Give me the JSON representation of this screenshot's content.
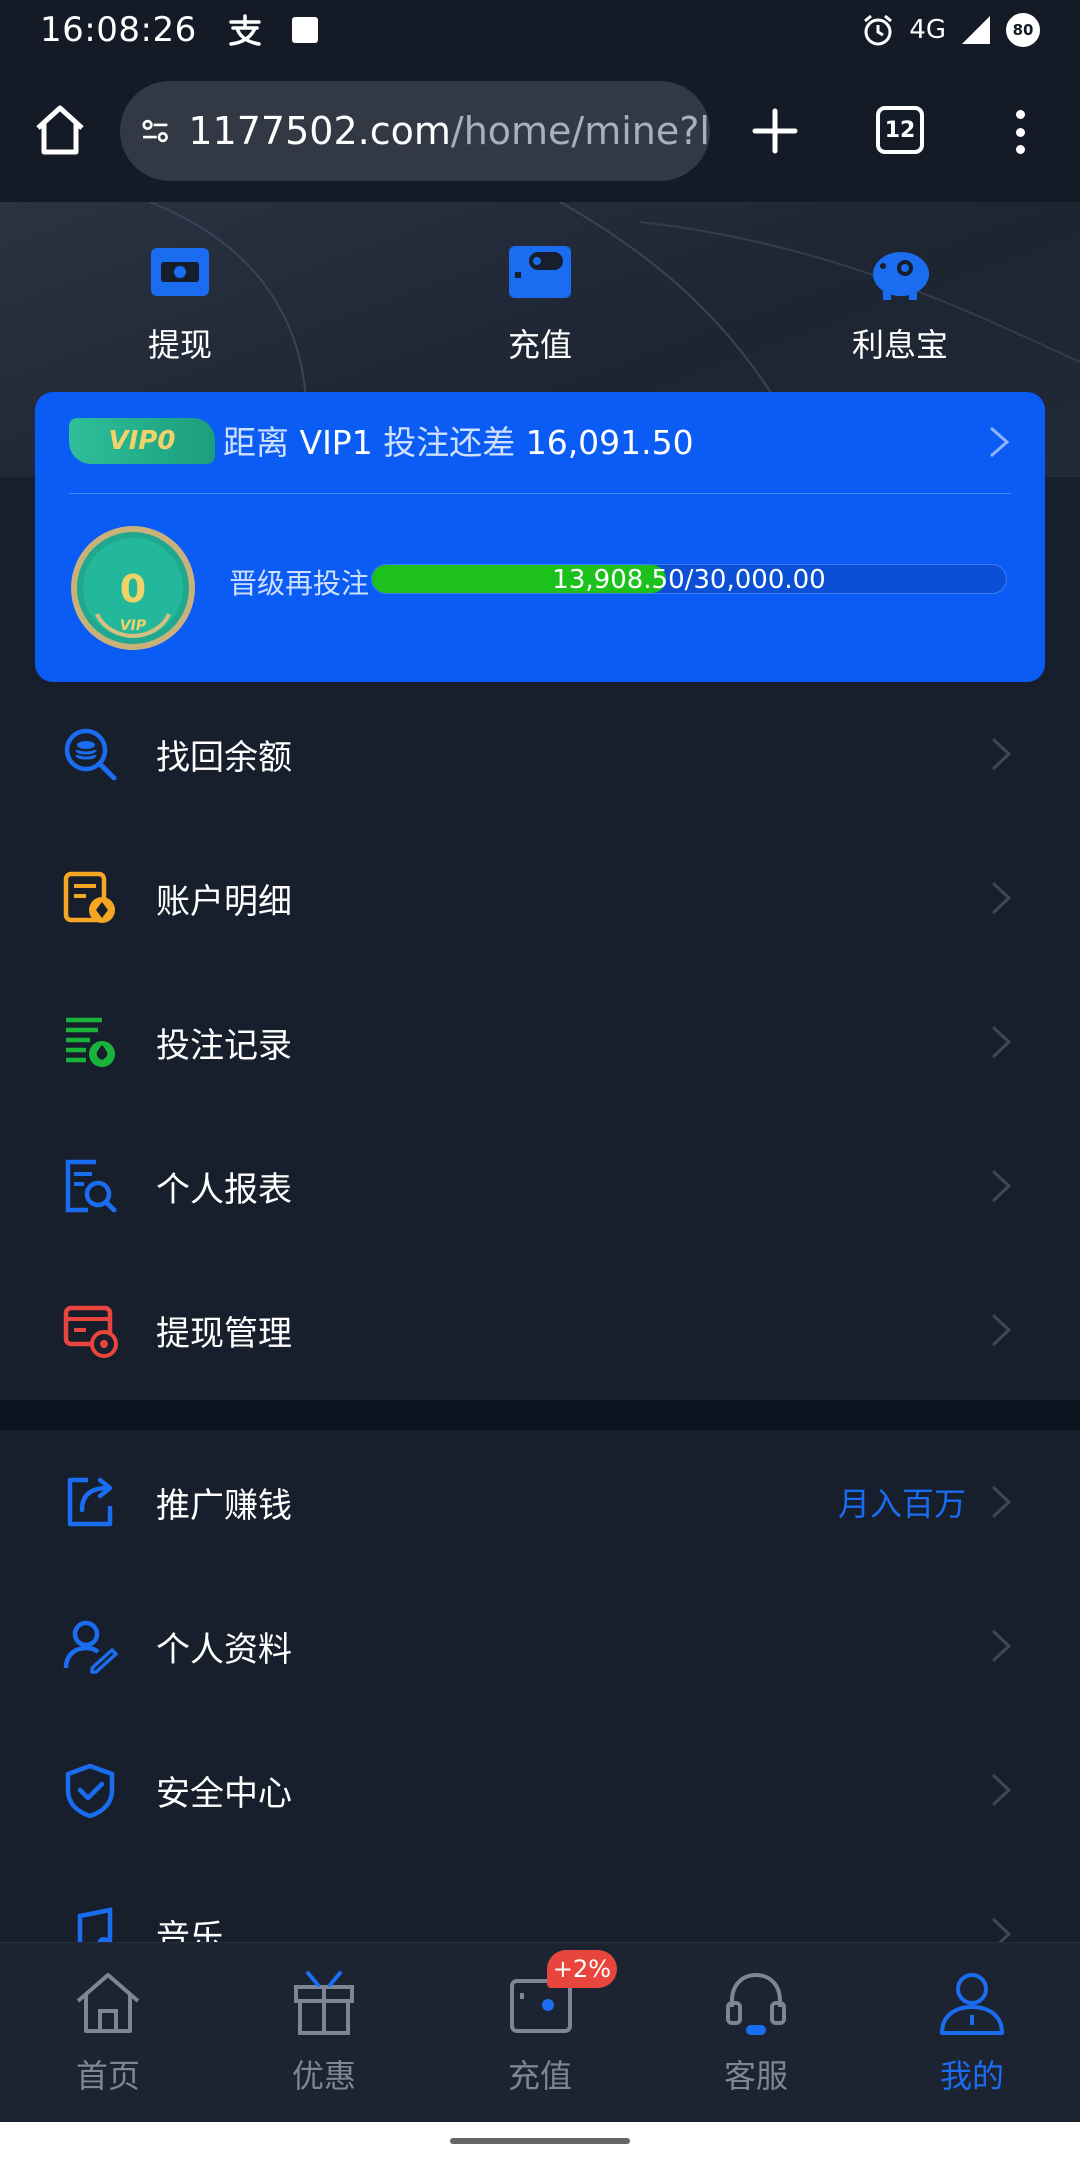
{
  "status_bar": {
    "time": "16:08:26",
    "network": "4G",
    "battery": "80"
  },
  "browser": {
    "url_host": "1177502.com",
    "url_path": "/home/mine?l",
    "tab_count": "12"
  },
  "actions": [
    {
      "label": "提现",
      "icon": "withdraw-cash-icon"
    },
    {
      "label": "充值",
      "icon": "wallet-icon"
    },
    {
      "label": "利息宝",
      "icon": "piggy-bank-icon"
    }
  ],
  "vip": {
    "badge": "VIP0",
    "title_prefix": "距离",
    "target_level": "VIP1",
    "title_mid": "投注还差",
    "remaining": "16,091.50",
    "medal_level": "0",
    "medal_caption": "VIP",
    "progress_label": "晋级再投注",
    "progress_text": "13,908.50/30,000.00",
    "progress_fraction": 0.4636
  },
  "menu_primary": [
    {
      "label": "找回余额",
      "icon": "search-coin-icon",
      "color": "#1a6cf0"
    },
    {
      "label": "账户明细",
      "icon": "account-detail-icon",
      "color": "#f5a623"
    },
    {
      "label": "投注记录",
      "icon": "bet-record-icon",
      "color": "#19b33a"
    },
    {
      "label": "个人报表",
      "icon": "report-icon",
      "color": "#1a6cf0"
    },
    {
      "label": "提现管理",
      "icon": "withdraw-manage-icon",
      "color": "#e8453c"
    }
  ],
  "menu_secondary": [
    {
      "label": "推广赚钱",
      "icon": "share-icon",
      "extra": "月入百万"
    },
    {
      "label": "个人资料",
      "icon": "user-edit-icon"
    },
    {
      "label": "安全中心",
      "icon": "shield-check-icon"
    },
    {
      "label": "音乐",
      "icon": "music-icon"
    }
  ],
  "bottom_nav": [
    {
      "label": "首页",
      "icon": "home-icon"
    },
    {
      "label": "优惠",
      "icon": "gift-icon"
    },
    {
      "label": "充值",
      "icon": "wallet-icon"
    },
    {
      "label": "客服",
      "icon": "headset-icon"
    },
    {
      "label": "我的",
      "icon": "user-icon",
      "active": true
    }
  ],
  "nav_badge": "+2%",
  "colors": {
    "accent": "#1a6cf0",
    "vip_card": "#0b5cf5",
    "progress": "#1cc11c",
    "background": "#171f2c"
  }
}
